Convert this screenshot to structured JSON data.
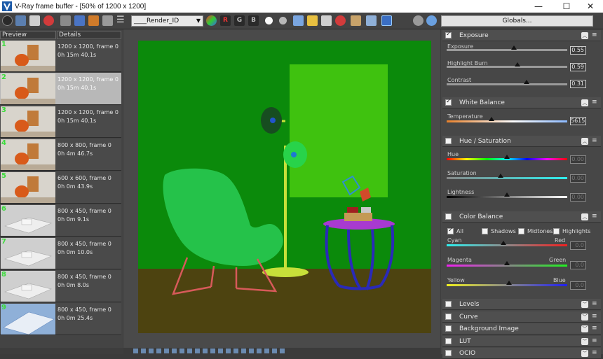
{
  "window": {
    "title": "V-Ray frame buffer - [50% of 1200 x 1200]",
    "minimize_glyph": "—",
    "maximize_glyph": "☐",
    "close_glyph": "✕"
  },
  "toolbar": {
    "channel_dropdown": "____Render_ID",
    "channel_buttons": [
      "R",
      "G",
      "B"
    ],
    "globals_label": "Globals..."
  },
  "history": {
    "columns": [
      "Preview",
      "Details"
    ],
    "items": [
      {
        "num": "1",
        "res": "1200 x 1200, frame 0",
        "time": "0h 15m 40.1s",
        "kind": "chair-room"
      },
      {
        "num": "2",
        "res": "1200 x 1200, frame 0",
        "time": "0h 15m 40.1s",
        "kind": "chair-room",
        "selected": true
      },
      {
        "num": "3",
        "res": "1200 x 1200, frame 0",
        "time": "0h 15m 40.1s",
        "kind": "chair-room"
      },
      {
        "num": "4",
        "res": "800 x 800, frame 0",
        "time": "0h 4m 46.7s",
        "kind": "chair-room"
      },
      {
        "num": "5",
        "res": "600 x 600, frame 0",
        "time": "0h 0m 43.9s",
        "kind": "chair-room"
      },
      {
        "num": "6",
        "res": "800 x 450, frame 0",
        "time": "0h 0m 9.1s",
        "kind": "white-model"
      },
      {
        "num": "7",
        "res": "800 x 450, frame 0",
        "time": "0h 0m 10.0s",
        "kind": "white-model"
      },
      {
        "num": "8",
        "res": "800 x 450, frame 0",
        "time": "0h 0m 8.0s",
        "kind": "white-model"
      },
      {
        "num": "9",
        "res": "800 x 450, frame 0",
        "time": "0h 0m 25.4s",
        "kind": "blue-model"
      }
    ]
  },
  "panel": {
    "exposure": {
      "title": "Exposure",
      "enabled": true,
      "exposure_label": "Exposure",
      "exposure_value": "0.55",
      "exposure_pos": 0.56,
      "highlight_label": "Highlight Burn",
      "highlight_value": "0.59",
      "highlight_pos": 0.59,
      "contrast_label": "Contrast",
      "contrast_value": "0.31",
      "contrast_pos": 0.66
    },
    "white_balance": {
      "title": "White Balance",
      "enabled": true,
      "temperature_label": "Temperature",
      "temperature_value": "5615",
      "temperature_pos": 0.37
    },
    "hue_saturation": {
      "title": "Hue / Saturation",
      "enabled": false,
      "hue_label": "Hue",
      "hue_value": "0.00",
      "hue_pos": 0.5,
      "saturation_label": "Saturation",
      "saturation_value": "0.00",
      "saturation_pos": 0.45,
      "lightness_label": "Lightness",
      "lightness_value": "0.00",
      "lightness_pos": 0.5
    },
    "color_balance": {
      "title": "Color Balance",
      "enabled": false,
      "opts": [
        "All",
        "Shadows",
        "Midtones",
        "Highlights"
      ],
      "cyan_label": "Cyan",
      "red_label": "Red",
      "cyan_red_value": "0.0",
      "cyan_red_pos": 0.47,
      "magenta_label": "Magenta",
      "green_label": "Green",
      "magenta_green_value": "0.0",
      "magenta_green_pos": 0.5,
      "yellow_label": "Yellow",
      "blue_label": "Blue",
      "yellow_blue_value": "0.0",
      "yellow_blue_pos": 0.52
    },
    "collapsed": [
      "Levels",
      "Curve",
      "Background Image",
      "LUT",
      "OCIO"
    ]
  },
  "colors": {
    "render_bg": "#0b8a0b",
    "floor": "#4d4310",
    "chair": "#25c24a",
    "frame_light": "#3fc20f",
    "lamp": "#c7e03a"
  }
}
